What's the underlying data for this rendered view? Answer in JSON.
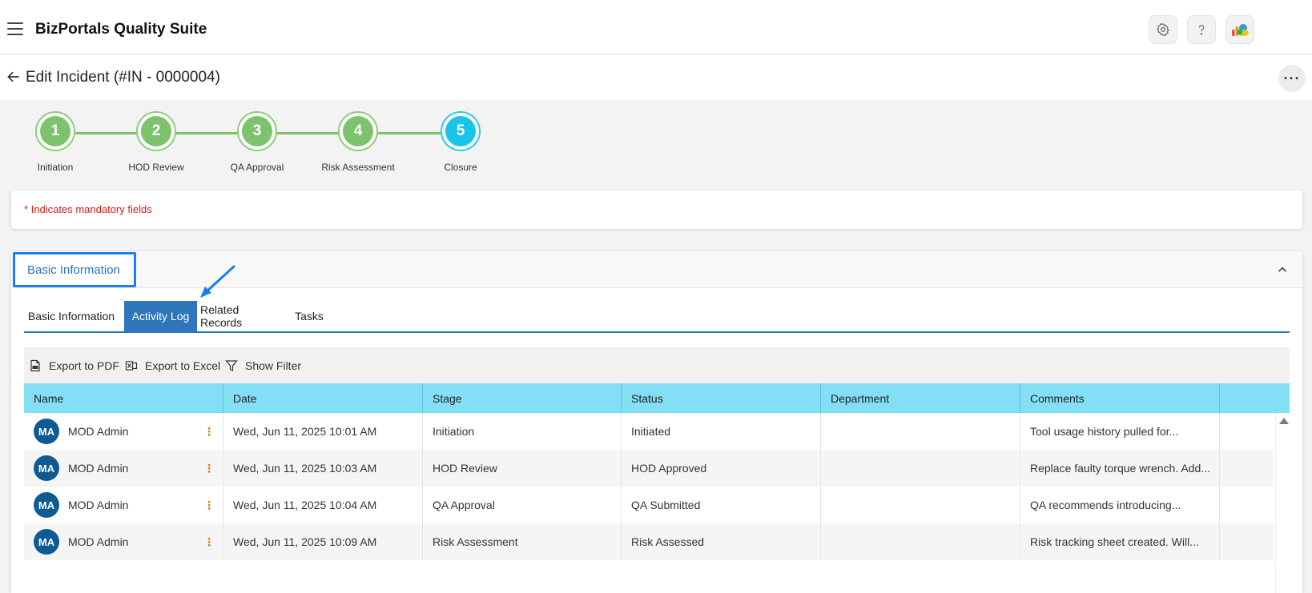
{
  "app": {
    "title": "BizPortals Quality Suite"
  },
  "page": {
    "title": "Edit Incident (#IN - 0000004)"
  },
  "stepper": {
    "steps": [
      {
        "number": "1",
        "label": "Initiation"
      },
      {
        "number": "2",
        "label": "HOD Review"
      },
      {
        "number": "3",
        "label": "QA Approval"
      },
      {
        "number": "4",
        "label": "Risk Assessment"
      },
      {
        "number": "5",
        "label": "Closure"
      }
    ],
    "active_step": 5
  },
  "note": {
    "mandatory": "* Indicates mandatory fields"
  },
  "section": {
    "title": "Basic Information"
  },
  "tabs": [
    {
      "label": "Basic Information"
    },
    {
      "label": "Activity Log"
    },
    {
      "label": "Related Records"
    },
    {
      "label": "Tasks"
    }
  ],
  "toolbar": {
    "export_pdf": "Export to PDF",
    "export_excel": "Export to Excel",
    "show_filter": "Show Filter"
  },
  "grid": {
    "columns": [
      "Name",
      "Date",
      "Stage",
      "Status",
      "Department",
      "Comments"
    ],
    "rows": [
      {
        "initials": "MA",
        "name": "MOD Admin",
        "date": "Wed, Jun 11, 2025 10:01 AM",
        "stage": "Initiation",
        "status": "Initiated",
        "department": "",
        "comments": "Tool usage history pulled for..."
      },
      {
        "initials": "MA",
        "name": "MOD Admin",
        "date": "Wed, Jun 11, 2025 10:03 AM",
        "stage": "HOD Review",
        "status": "HOD Approved",
        "department": "",
        "comments": "Replace faulty torque wrench. Add..."
      },
      {
        "initials": "MA",
        "name": "MOD Admin",
        "date": "Wed, Jun 11, 2025 10:04 AM",
        "stage": "QA Approval",
        "status": "QA Submitted",
        "department": "",
        "comments": "QA recommends introducing..."
      },
      {
        "initials": "MA",
        "name": "MOD Admin",
        "date": "Wed, Jun 11, 2025 10:09 AM",
        "stage": "Risk Assessment",
        "status": "Risk Assessed",
        "department": "",
        "comments": "Risk tracking sheet created. Will..."
      }
    ]
  },
  "icons": {
    "menu": "hamburger-icon",
    "settings": "gear-icon",
    "help": "help-icon",
    "app_launcher": "cloud-logo-icon",
    "back": "arrow-left-icon",
    "more": "ellipsis-icon",
    "collapse": "chevron-up-icon",
    "pdf": "pdf-file-icon",
    "excel": "excel-file-icon",
    "filter": "filter-icon"
  },
  "colors": {
    "step_complete": "#7dc36d",
    "step_active": "#18c4ea",
    "tab_active": "#2f76bb",
    "grid_header": "#83dff5",
    "avatar": "#0e5a94",
    "mandatory_text": "#d91a1a",
    "highlight_box": "#1a7ef0"
  }
}
